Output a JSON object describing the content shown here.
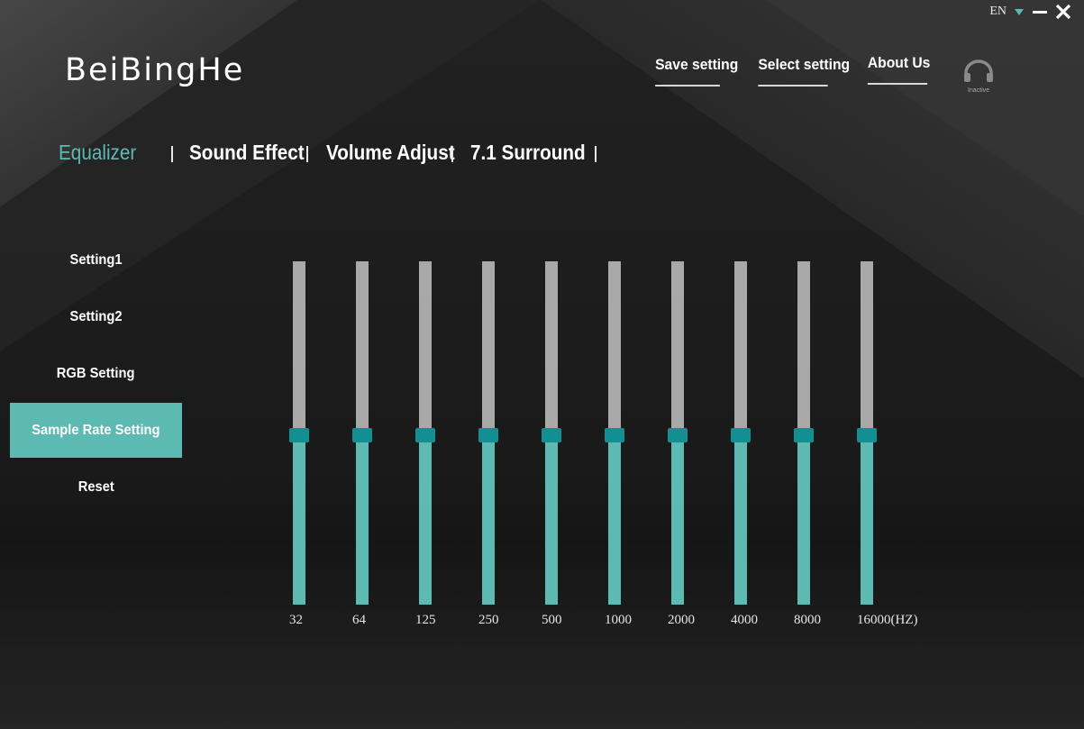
{
  "app": {
    "logo": "BeiBingHe",
    "language": "EN",
    "accent_color": "#5dbab3",
    "thumb_color": "#138e91",
    "track_color": "#a9a9a9"
  },
  "top_nav": [
    {
      "label": "Save setting"
    },
    {
      "label": "Select setting"
    },
    {
      "label": "About Us"
    }
  ],
  "headset": {
    "icon": "headset-icon",
    "status": "Inactive"
  },
  "tabs": [
    {
      "label": "Equalizer",
      "active": true
    },
    {
      "label": "Sound Effect",
      "active": false
    },
    {
      "label": "Volume Adjust",
      "active": false
    },
    {
      "label": "7.1 Surround",
      "active": false
    }
  ],
  "sidebar": [
    {
      "label": "Setting1",
      "active": false
    },
    {
      "label": "Setting2",
      "active": false
    },
    {
      "label": "RGB Setting",
      "active": false
    },
    {
      "label": "Sample Rate Setting",
      "active": true
    },
    {
      "label": "Reset",
      "active": false
    }
  ],
  "equalizer": {
    "bands": [
      {
        "freq": "32",
        "level": 0.5
      },
      {
        "freq": "64",
        "level": 0.5
      },
      {
        "freq": "125",
        "level": 0.5
      },
      {
        "freq": "250",
        "level": 0.5
      },
      {
        "freq": "500",
        "level": 0.5
      },
      {
        "freq": "1000",
        "level": 0.5
      },
      {
        "freq": "2000",
        "level": 0.5
      },
      {
        "freq": "4000",
        "level": 0.5
      },
      {
        "freq": "8000",
        "level": 0.5
      },
      {
        "freq": "16000(HZ)",
        "level": 0.5
      }
    ]
  }
}
